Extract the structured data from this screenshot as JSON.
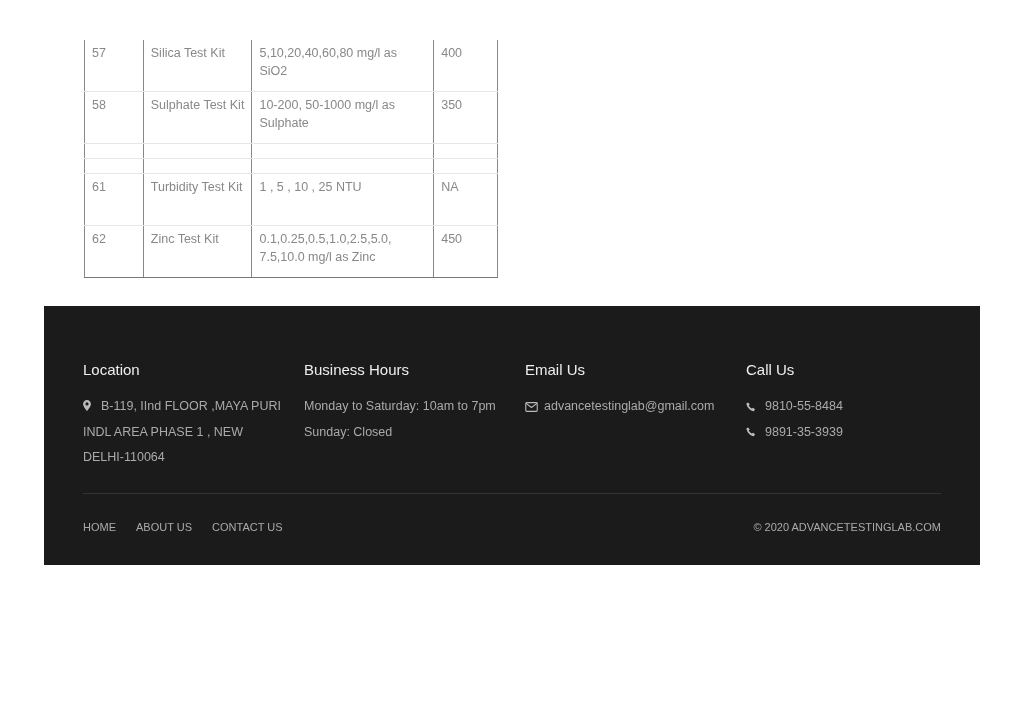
{
  "table": {
    "rows": [
      {
        "kind": "item",
        "cells": [
          "57",
          "Silica Test Kit",
          "5,10,20,40,60,80 mg/l as SiO2",
          "400"
        ]
      },
      {
        "kind": "item",
        "cells": [
          "58",
          "Sulphate Test Kit",
          "10-200, 50-1000 mg/l as Sulphate",
          "350"
        ]
      },
      {
        "kind": "blank"
      },
      {
        "kind": "blank"
      },
      {
        "kind": "item",
        "cells": [
          "61",
          "Turbidity Test Kit",
          "1 , 5 , 10 , 25 NTU",
          "NA"
        ]
      },
      {
        "kind": "item",
        "cells": [
          "62",
          "Zinc Test Kit",
          "0.1,0.25,0.5,1.0,2.5,5.0, 7.5,10.0 mg/l as Zinc",
          "450"
        ]
      }
    ]
  },
  "footer": {
    "columns": [
      {
        "heading": "Location",
        "items": [
          {
            "kind": "address",
            "text": "B-119, IInd FLOOR ,MAYA PURI INDL AREA PHASE 1 , NEW DELHI-110064"
          }
        ]
      },
      {
        "heading": "Business Hours",
        "items": [
          {
            "kind": "plain",
            "text": "Monday to Saturday: 10am to 7pm"
          },
          {
            "kind": "plain",
            "text": "Sunday: Closed"
          }
        ]
      },
      {
        "heading": "Email Us",
        "items": [
          {
            "kind": "email",
            "text": "advancetestinglab@gmail.com"
          }
        ]
      },
      {
        "heading": "Call Us",
        "items": [
          {
            "kind": "phone",
            "text": "9810-55-8484"
          },
          {
            "kind": "phone",
            "text": "9891-35-3939"
          }
        ]
      }
    ],
    "nav": [
      "HOME",
      "ABOUT US",
      "CONTACT US"
    ],
    "copyright": "© 2020 ADVANCETESTINGLAB.COM"
  }
}
